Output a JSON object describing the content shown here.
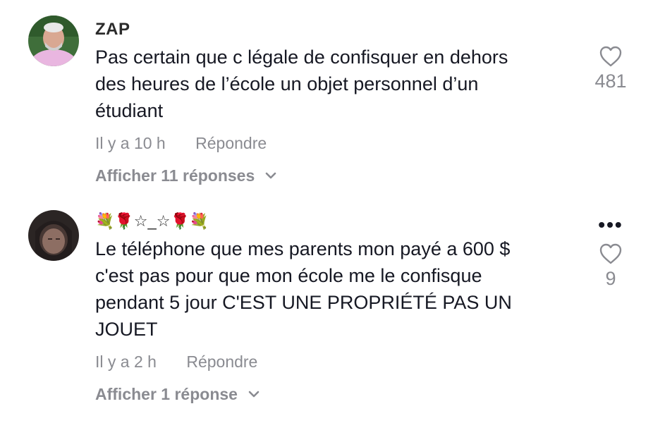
{
  "comments": [
    {
      "username": "ZAP",
      "text_lines": [
        "Pas certain que c légale de confisquer en dehors",
        "des heures de l’école un objet personnel d’un",
        "étudiant"
      ],
      "time": "Il y a 10 h",
      "reply_label": "Répondre",
      "view_replies": "Afficher 11 réponses",
      "likes": "481",
      "avatar": "avatar-bald-man-pink-hoodie"
    },
    {
      "username": "💐🌹☆_☆🌹💐",
      "text_lines": [
        "Le téléphone que mes parents mon payé a 600 $",
        "c'est pas pour que mon école me le confisque",
        "pendant 5 jour C'EST UNE PROPRIÉTÉ PAS UN",
        "JOUET"
      ],
      "time": "Il y a 2 h",
      "reply_label": "Répondre",
      "view_replies": "Afficher 1 réponse",
      "likes": "9",
      "more_label": "•••",
      "avatar": "avatar-dark-selfie"
    }
  ],
  "icons": {
    "like": "heart-outline-icon",
    "expand": "chevron-down-icon",
    "more": "more-dots-icon"
  },
  "colors": {
    "text": "#161823",
    "muted": "#8a8b91",
    "background": "#ffffff"
  }
}
